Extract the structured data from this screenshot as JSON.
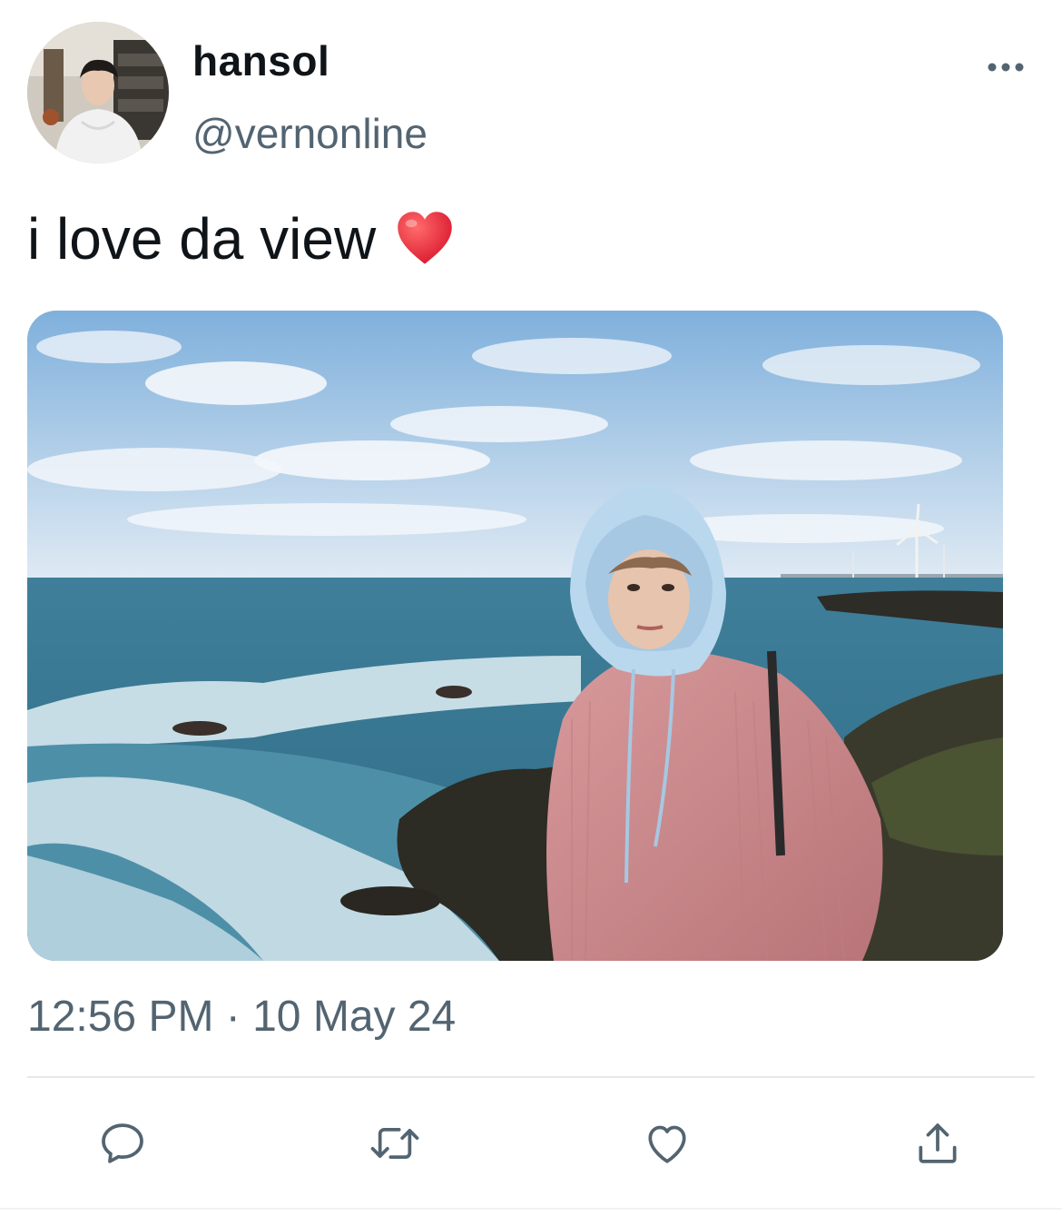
{
  "author": {
    "display_name": "hansol",
    "handle": "@vernonline"
  },
  "tweet": {
    "text": "i love da view",
    "emoji": "red-heart",
    "timestamp": "12:56 PM · 10 May 24"
  },
  "icons": {
    "more": "more-horizontal-icon",
    "reply": "reply-icon",
    "retweet": "retweet-icon",
    "like": "like-icon",
    "share": "share-icon"
  },
  "colors": {
    "text_primary": "#0f1419",
    "text_secondary": "#536471",
    "icon": "#536471",
    "heart": "#e0243a"
  }
}
